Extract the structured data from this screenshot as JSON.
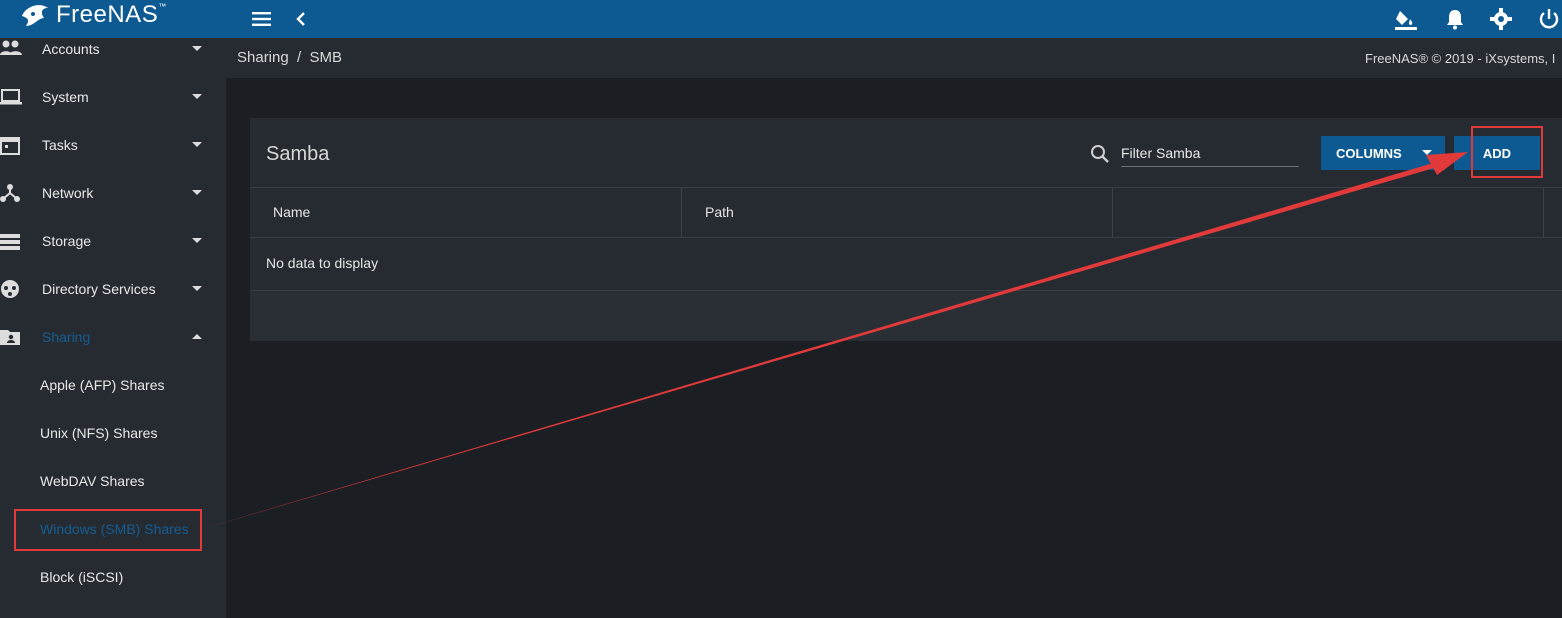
{
  "app": {
    "logo_text": "FreeNAS",
    "logo_tm": "™"
  },
  "topbar": {
    "icons": [
      "menu-icon",
      "back-chevron-icon",
      "theme-paint-icon",
      "bell-icon",
      "gear-icon",
      "power-icon"
    ]
  },
  "sidebar": {
    "items": [
      {
        "label": "Accounts",
        "icon": "people-icon",
        "expanded": false
      },
      {
        "label": "System",
        "icon": "laptop-icon",
        "expanded": false
      },
      {
        "label": "Tasks",
        "icon": "calendar-icon",
        "expanded": false
      },
      {
        "label": "Network",
        "icon": "network-icon",
        "expanded": false
      },
      {
        "label": "Storage",
        "icon": "storage-icon",
        "expanded": false
      },
      {
        "label": "Directory Services",
        "icon": "directory-icon",
        "expanded": false
      },
      {
        "label": "Sharing",
        "icon": "folder-shared-icon",
        "expanded": true
      }
    ],
    "sharing_subitems": [
      {
        "label": "Apple (AFP) Shares"
      },
      {
        "label": "Unix (NFS) Shares"
      },
      {
        "label": "WebDAV Shares"
      },
      {
        "label": "Windows (SMB) Shares",
        "active": true
      },
      {
        "label": "Block (iSCSI)"
      }
    ]
  },
  "breadcrumb": {
    "text": "Sharing  /  SMB"
  },
  "copyright": "FreeNAS® © 2019 - iXsystems, I",
  "card": {
    "title": "Samba",
    "filter_placeholder": "Filter Samba",
    "columns_button": "COLUMNS",
    "add_button": "ADD",
    "table": {
      "headers": [
        "Name",
        "Path",
        ""
      ],
      "empty_message": "No data to display"
    }
  },
  "colors": {
    "accent": "#0d5a92",
    "annotation": "#e23a3a",
    "sidebar_bg": "#262b32",
    "page_bg": "#1b1f24"
  }
}
